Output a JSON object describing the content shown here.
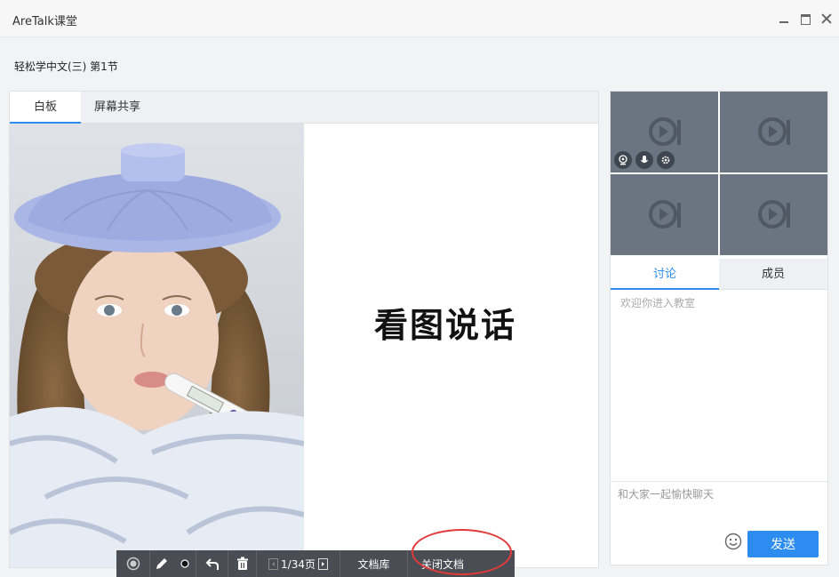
{
  "window": {
    "title": "AreTalk课堂"
  },
  "course": {
    "title": "轻松学中文(三)  第1节"
  },
  "main_tabs": [
    {
      "label": "白板",
      "active": true
    },
    {
      "label": "屏幕共享",
      "active": false
    }
  ],
  "whiteboard": {
    "slide_text": "看图说话",
    "image_icon": "girl-sick-thermometer-photo"
  },
  "toolbar": {
    "page_indicator": "1/34页",
    "doc_library_label": "文档库",
    "close_doc_label": "关闭文档"
  },
  "chat": {
    "tabs": [
      {
        "label": "讨论",
        "active": true
      },
      {
        "label": "成员",
        "active": false
      }
    ],
    "messages": [
      "欢迎你进入教室"
    ],
    "input_placeholder": "和大家一起愉快聊天",
    "send_label": "发送"
  },
  "colors": {
    "accent": "#2d8cf0",
    "video_bg": "#6b7581",
    "toolbar_bg": "#4a4e54",
    "highlight": "#e23a3a"
  }
}
